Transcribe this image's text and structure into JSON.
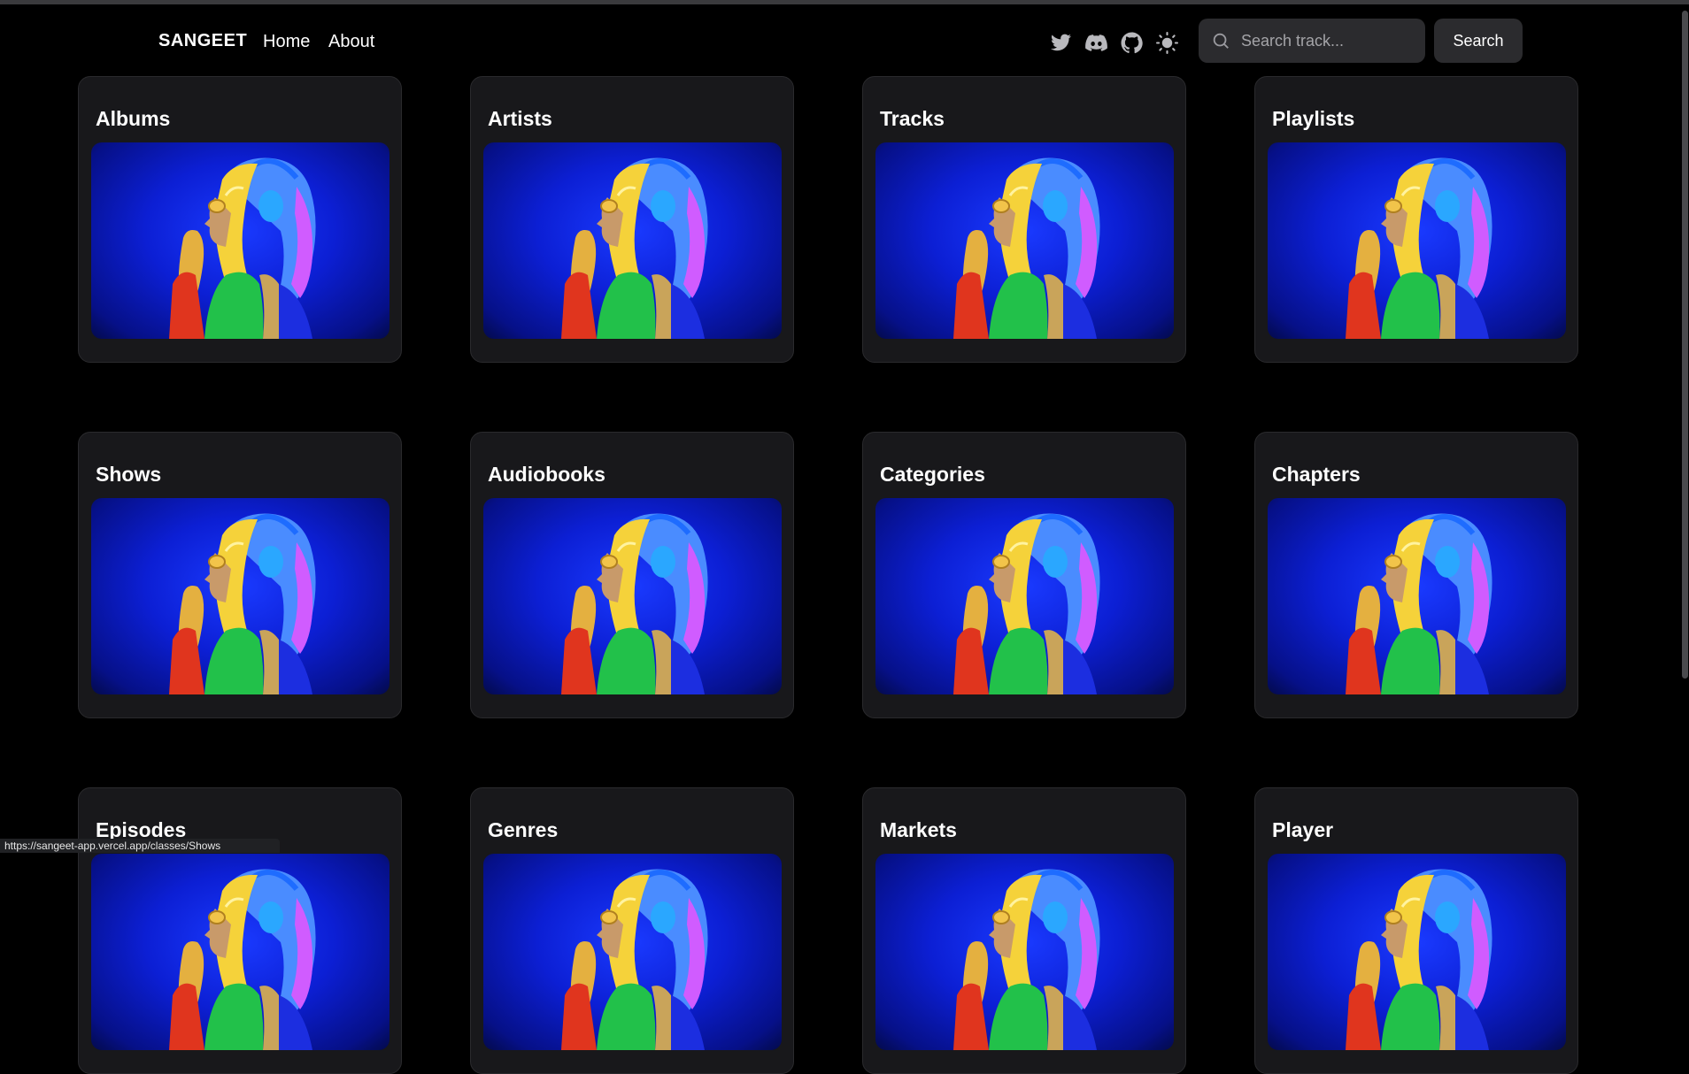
{
  "brand": "SANGEET",
  "nav": {
    "home": "Home",
    "about": "About"
  },
  "icons": [
    "twitter-icon",
    "discord-icon",
    "github-icon",
    "sun-icon"
  ],
  "search": {
    "placeholder": "Search track...",
    "button": "Search"
  },
  "cards": [
    {
      "title": "Albums"
    },
    {
      "title": "Artists"
    },
    {
      "title": "Tracks"
    },
    {
      "title": "Playlists"
    },
    {
      "title": "Shows"
    },
    {
      "title": "Audiobooks"
    },
    {
      "title": "Categories"
    },
    {
      "title": "Chapters"
    },
    {
      "title": "Episodes"
    },
    {
      "title": "Genres"
    },
    {
      "title": "Markets"
    },
    {
      "title": "Player"
    }
  ],
  "status_url": "https://sangeet-app.vercel.app/classes/Shows",
  "colors": {
    "background": "#000000",
    "card": "#18181b",
    "accent_blue": "#0c1fd4"
  }
}
